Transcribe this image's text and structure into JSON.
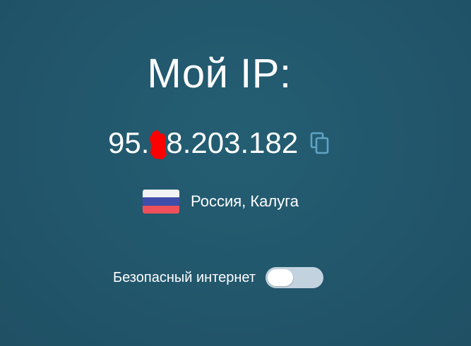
{
  "header": {
    "title": "Мой IP:"
  },
  "ip": {
    "prefix": "95.",
    "redacted": true,
    "suffix": "8.203.182",
    "copy_icon": "copy-icon"
  },
  "location": {
    "country_flag": "russia-flag",
    "text": "Россия, Калуга"
  },
  "safe_internet": {
    "label": "Безопасный интернет",
    "enabled": false
  },
  "colors": {
    "background": "#235a6e",
    "text": "#ffffff",
    "copy_icon": "#5fa3c6",
    "redaction": "#ff0000",
    "toggle_track": "#c2d3df",
    "flag_white": "#f3f3f3",
    "flag_blue": "#3f4ea8",
    "flag_red": "#f0505a"
  }
}
